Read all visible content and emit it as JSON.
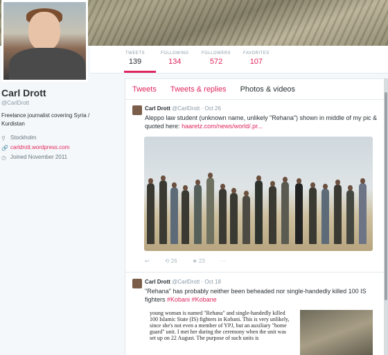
{
  "profile": {
    "name": "Carl Drott",
    "handle": "@CarlDrott",
    "bio": "Freelance journalist covering Syria / Kurdistan",
    "location": "Stockholm",
    "website": "carldrott.wordpress.com",
    "joined": "Joined November 2011"
  },
  "stats": [
    {
      "label": "TWEETS",
      "value": "139"
    },
    {
      "label": "FOLLOWING",
      "value": "134"
    },
    {
      "label": "FOLLOWERS",
      "value": "572"
    },
    {
      "label": "FAVORITES",
      "value": "107"
    }
  ],
  "tabs": [
    "Tweets",
    "Tweets & replies",
    "Photos & videos"
  ],
  "tweets": [
    {
      "author": "Carl Drott",
      "handle": "@CarlDrott",
      "date": "Oct 26",
      "text": "Aleppo law student (unknown name, unlikely \"Rehana\") shown in middle of my pic & quoted here:",
      "link": "haaretz.com/news/world/.pr...",
      "retweets": "26",
      "favorites": "23"
    },
    {
      "author": "Carl Drott",
      "handle": "@CarlDrott",
      "date": "Oct 18",
      "text": "\"Rehana\" has probably neither been beheaded nor single-handedly killed 100 IS fighters",
      "hashtags": "#Kobani #Kobane",
      "article": "young woman is named \"Rehana\" and single-handedly killed 100 Islamic State (IS) fighters in Kobani. This is very unlikely, since she's not even a member of YPJ, but an auxiliary \"home guard\" unit. I met her during the ceremony when the unit was set up on 22 August. The purpose of such units is"
    }
  ],
  "icons": {
    "location": "location-pin-icon",
    "link": "link-icon",
    "calendar": "calendar-icon",
    "reply": "reply-icon",
    "retweet": "retweet-icon",
    "favorite": "star-icon",
    "more": "more-icon"
  },
  "colors": {
    "accent": "#e0245e"
  }
}
